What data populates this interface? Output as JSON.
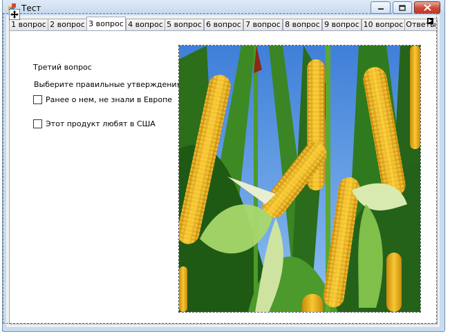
{
  "window": {
    "title": "Тест",
    "icon": "app-form-icon",
    "buttons": [
      "minimize-icon",
      "maximize-icon",
      "close-icon"
    ]
  },
  "tabs": [
    {
      "label": "1 вопрос",
      "active": false
    },
    {
      "label": "2 вопрос",
      "active": false
    },
    {
      "label": "3 вопрос",
      "active": true
    },
    {
      "label": "4 вопрос",
      "active": false
    },
    {
      "label": "5 вопрос",
      "active": false
    },
    {
      "label": "6 вопрос",
      "active": false
    },
    {
      "label": "7 вопрос",
      "active": false
    },
    {
      "label": "8 вопрос",
      "active": false
    },
    {
      "label": "9 вопрос",
      "active": false
    },
    {
      "label": "10 вопрос",
      "active": false
    },
    {
      "label": "Ответы",
      "active": false
    }
  ],
  "question": {
    "title": "Третий вопрос",
    "instruction": "Выберите правильные утверждения",
    "options": [
      {
        "label": "Ранее о нем, не знали в Европе",
        "checked": false
      },
      {
        "label": "Этот продукт любят в США",
        "checked": false
      }
    ]
  },
  "picture": {
    "subject": "corn-cobs-photo"
  },
  "colors": {
    "frame": "#c9dbef",
    "close_button": "#c94a37",
    "sky": "#4f8fe0",
    "corn": "#f2b21c",
    "leaf": "#2f7a1e"
  }
}
